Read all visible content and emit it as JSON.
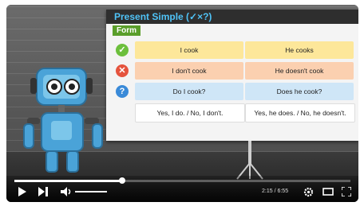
{
  "slide": {
    "title": "Present Simple (✓×?)",
    "form_label": "Form",
    "rows": [
      {
        "icon": "check",
        "col1": "I cook",
        "col2": "He cooks"
      },
      {
        "icon": "cross",
        "col1": "I don't cook",
        "col2": "He doesn't cook"
      },
      {
        "icon": "question",
        "col1": "Do I cook?",
        "col2": "Does he cook?"
      },
      {
        "icon": "",
        "col1": "Yes, I do. / No, I don't.",
        "col2": "Yes, he does. / No, he doesn't."
      }
    ]
  },
  "player": {
    "progress_fraction": 0.32,
    "time": "2:15 / 6:55",
    "icons": [
      "play-icon",
      "next-icon",
      "volume-icon",
      "settings-icon",
      "theater-icon",
      "fullscreen-icon"
    ]
  },
  "colors": {
    "green": "#6cbf3c",
    "red": "#e5533d",
    "blue": "#3a8ad8"
  }
}
